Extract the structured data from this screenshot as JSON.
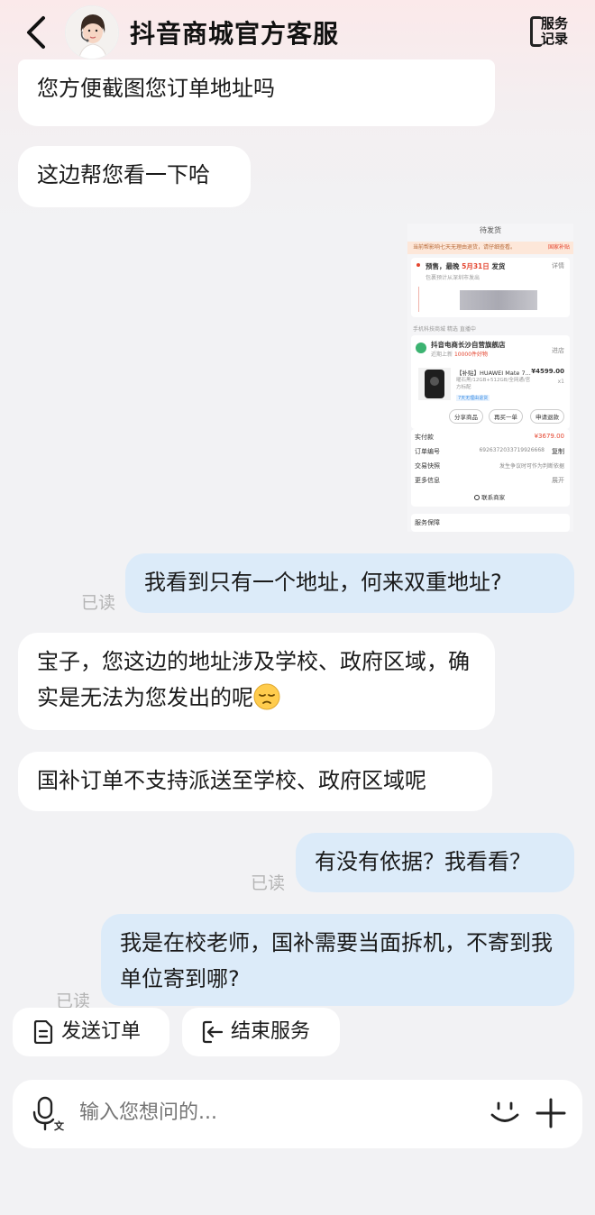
{
  "header": {
    "title": "抖音商城官方客服",
    "service_record": "服务记录"
  },
  "messages": [
    {
      "side": "left",
      "text": "您方便截图您订单地址吗"
    },
    {
      "side": "left",
      "text": "这边帮您看一下哈"
    },
    {
      "side": "right",
      "text": "我看到只有一个地址，何来双重地址?",
      "status": "已读"
    },
    {
      "side": "left",
      "text": "宝子，您这边的地址涉及学校、政府区域，确实是无法为您发出的呢",
      "emoji": "pensive-emoji"
    },
    {
      "side": "left",
      "text": "国补订单不支持派送至学校、政府区域呢"
    },
    {
      "side": "right",
      "text": "有没有依据？我看看？",
      "status": "已读"
    },
    {
      "side": "right",
      "text": "我是在校老师，国补需要当面拆机，不寄到我单位寄到哪?",
      "status": "已读"
    }
  ],
  "screenshot": {
    "page_title": "待发货",
    "notice": "当前帮影响七天无理由退货，请仔细查看。",
    "notice_right": "国家补贴",
    "presale": "预售，最晚",
    "date": "5月31日",
    "ship": "发货",
    "detail": "详情",
    "ship_from": "包裹预计从深圳市发出",
    "breadcrumb": "手机科技商城 精选 直播中",
    "store_name": "抖音电商长沙自营旗舰店",
    "store_sub": "近期上新",
    "store_sub_count": "10000件好物",
    "store_enter": "进店",
    "product_name": "【补贴】HUAWEI Mate 7...",
    "product_price": "¥4599.00",
    "product_spec": "曜石黑/12GB+512GB/全网通/官方标配",
    "product_qty": "x1",
    "product_tag": "7天无理由退货",
    "btn_share": "分享商品",
    "btn_rebuy": "再买一单",
    "btn_refund": "申请退款",
    "paid_label": "实付款",
    "paid_value": "¥3679.00",
    "order_label": "订单编号",
    "order_value": "6926372033719926668",
    "copy": "复制",
    "snapshot_label": "交易快照",
    "snapshot_value": "发生争议时可作为判断依据",
    "more_label": "更多信息",
    "expand": "展开",
    "contact": "联系商家",
    "guarantee": "服务保障"
  },
  "actions": {
    "send_order": "发送订单",
    "end_service": "结束服务"
  },
  "input": {
    "placeholder": "输入您想问的..."
  }
}
